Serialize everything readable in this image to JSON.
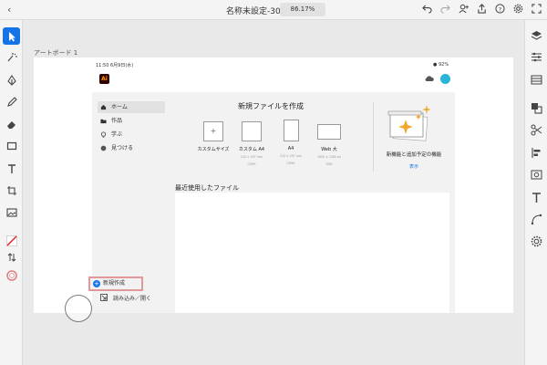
{
  "topbar": {
    "document_title": "名称未設定-30",
    "zoom": "86.17%"
  },
  "artboard": {
    "label": "アートボード 1"
  },
  "device_status": {
    "time_date": "11:50  6月9日(水)",
    "battery": "92%"
  },
  "app": {
    "logo_text": "Ai"
  },
  "sidebar": {
    "items": [
      {
        "label": "ホーム",
        "icon": "home-icon"
      },
      {
        "label": "作品",
        "icon": "folder-icon"
      },
      {
        "label": "学ぶ",
        "icon": "lightbulb-icon"
      },
      {
        "label": "見つける",
        "icon": "discover-icon"
      }
    ],
    "new_label": "新規作成",
    "open_label": "読み込み／開く"
  },
  "new_file": {
    "title": "新規ファイルを作成",
    "templates": [
      {
        "label": "カスタムサイズ",
        "sub1": "",
        "sub2": ""
      },
      {
        "label": "カスタム A4",
        "sub1": "210 × 297 mm",
        "sub2": "CMYK"
      },
      {
        "label": "A4",
        "sub1": "210 × 297 mm",
        "sub2": "CMYK"
      },
      {
        "label": "Web 大",
        "sub1": "1920 × 1080 px",
        "sub2": "RGB"
      }
    ]
  },
  "feature": {
    "title": "新機能と追加予定の機能",
    "link": "表示"
  },
  "recent": {
    "title": "最近使用したファイル"
  },
  "colors": {
    "accent": "#1473e6",
    "highlight_border": "#e09898",
    "avatar": "#28b5d7"
  }
}
